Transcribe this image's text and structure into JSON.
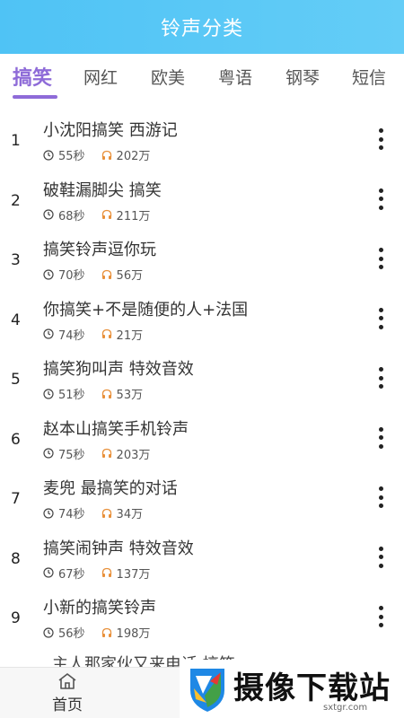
{
  "header": {
    "title": "铃声分类"
  },
  "tabs": [
    {
      "label": "搞笑",
      "active": true
    },
    {
      "label": "网红",
      "active": false
    },
    {
      "label": "欧美",
      "active": false
    },
    {
      "label": "粤语",
      "active": false
    },
    {
      "label": "钢琴",
      "active": false
    },
    {
      "label": "短信",
      "active": false
    }
  ],
  "list": [
    {
      "num": "1",
      "title": "小沈阳搞笑 西游记",
      "duration": "55秒",
      "plays": "202万"
    },
    {
      "num": "2",
      "title": "破鞋漏脚尖 搞笑",
      "duration": "68秒",
      "plays": "211万"
    },
    {
      "num": "3",
      "title": "搞笑铃声逗你玩",
      "duration": "70秒",
      "plays": "56万"
    },
    {
      "num": "4",
      "title": "你搞笑+不是随便的人+法国",
      "duration": "74秒",
      "plays": "21万"
    },
    {
      "num": "5",
      "title": "搞笑狗叫声 特效音效",
      "duration": "51秒",
      "plays": "53万"
    },
    {
      "num": "6",
      "title": "赵本山搞笑手机铃声",
      "duration": "75秒",
      "plays": "203万"
    },
    {
      "num": "7",
      "title": "麦兜 最搞笑的对话",
      "duration": "74秒",
      "plays": "34万"
    },
    {
      "num": "8",
      "title": "搞笑闹钟声 特效音效",
      "duration": "67秒",
      "plays": "137万"
    },
    {
      "num": "9",
      "title": "小新的搞笑铃声",
      "duration": "56秒",
      "plays": "198万"
    }
  ],
  "partial_row": {
    "title": "主人那家伙又来电话 搞笑"
  },
  "bottom_nav": {
    "home_label": "首页"
  },
  "watermark": {
    "text": "摄像下载站",
    "url": "sxtgr.com"
  },
  "colors": {
    "header": "#4fc3f5",
    "accent": "#8e6bd8",
    "headphone": "#e8903a"
  },
  "icons": {
    "duration": "clock-icon",
    "plays": "headphones-icon",
    "more": "more-vertical-icon",
    "home": "home-icon"
  }
}
